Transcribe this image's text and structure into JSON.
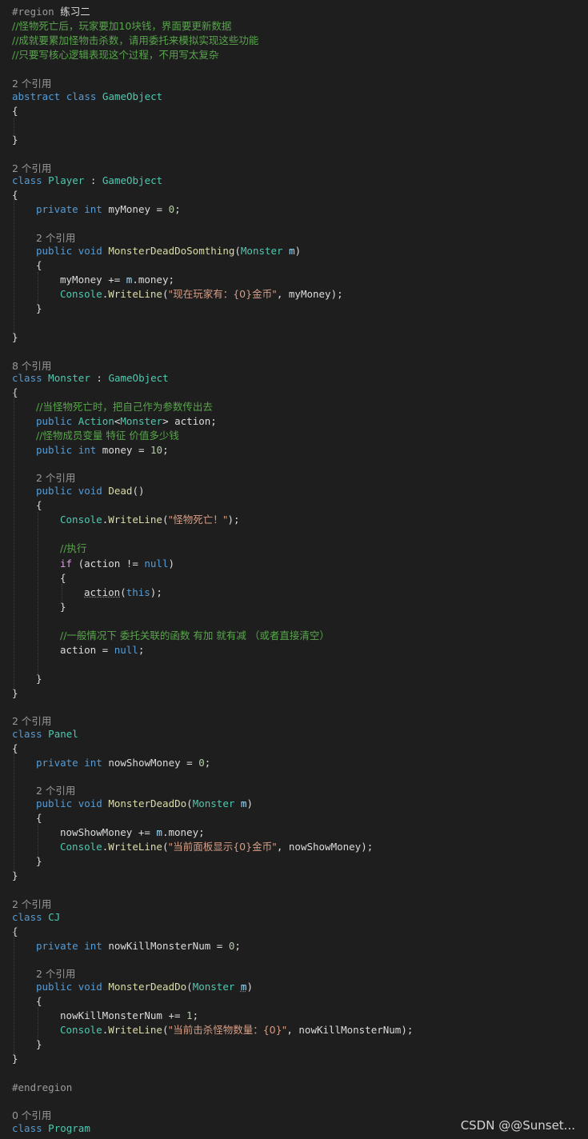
{
  "code": {
    "lines": [
      {
        "kind": "code",
        "spans": [
          {
            "t": "#region ",
            "c": "pre"
          },
          {
            "t": "练习二",
            "c": "plain"
          }
        ]
      },
      {
        "kind": "code",
        "spans": [
          {
            "t": "//怪物死亡后，玩家要加10块钱，界面要更新数据",
            "c": "cmt"
          }
        ]
      },
      {
        "kind": "code",
        "spans": [
          {
            "t": "//成就要累加怪物击杀数，请用委托来模拟实现这些功能",
            "c": "cmt"
          }
        ]
      },
      {
        "kind": "code",
        "spans": [
          {
            "t": "//只要写核心逻辑表现这个过程，不用写太复杂",
            "c": "cmt"
          }
        ]
      },
      {
        "kind": "lens",
        "spans": [
          {
            "t": "2 个引用",
            "c": "lens"
          }
        ]
      },
      {
        "kind": "code",
        "spans": [
          {
            "t": "abstract",
            "c": "kw"
          },
          {
            "t": " ",
            "c": "plain"
          },
          {
            "t": "class",
            "c": "kw"
          },
          {
            "t": " ",
            "c": "plain"
          },
          {
            "t": "GameObject",
            "c": "type"
          }
        ]
      },
      {
        "kind": "code",
        "spans": [
          {
            "t": "{",
            "c": "plain"
          }
        ]
      },
      {
        "kind": "code",
        "spans": [
          {
            "t": "}",
            "c": "plain"
          }
        ]
      },
      {
        "kind": "lens",
        "spans": [
          {
            "t": "2 个引用",
            "c": "lens"
          }
        ]
      },
      {
        "kind": "code",
        "spans": [
          {
            "t": "class",
            "c": "kw"
          },
          {
            "t": " ",
            "c": "plain"
          },
          {
            "t": "Player",
            "c": "type"
          },
          {
            "t": " : ",
            "c": "plain"
          },
          {
            "t": "GameObject",
            "c": "type"
          }
        ]
      },
      {
        "kind": "code",
        "spans": [
          {
            "t": "{",
            "c": "plain"
          }
        ]
      },
      {
        "kind": "code",
        "spans": [
          {
            "t": "private",
            "c": "kw"
          },
          {
            "t": " ",
            "c": "plain"
          },
          {
            "t": "int",
            "c": "kw"
          },
          {
            "t": " myMoney = ",
            "c": "plain"
          },
          {
            "t": "0",
            "c": "num"
          },
          {
            "t": ";",
            "c": "plain"
          }
        ]
      },
      {
        "kind": "lens",
        "spans": [
          {
            "t": "2 个引用",
            "c": "lens"
          }
        ]
      },
      {
        "kind": "code",
        "spans": [
          {
            "t": "public",
            "c": "kw"
          },
          {
            "t": " ",
            "c": "plain"
          },
          {
            "t": "void",
            "c": "kw"
          },
          {
            "t": " ",
            "c": "plain"
          },
          {
            "t": "MonsterDeadDoSomthing",
            "c": "fn"
          },
          {
            "t": "(",
            "c": "plain"
          },
          {
            "t": "Monster",
            "c": "type"
          },
          {
            "t": " ",
            "c": "plain"
          },
          {
            "t": "m",
            "c": "prm"
          },
          {
            "t": ")",
            "c": "plain"
          }
        ]
      },
      {
        "kind": "code",
        "spans": [
          {
            "t": "{",
            "c": "plain"
          }
        ]
      },
      {
        "kind": "code",
        "spans": [
          {
            "t": "myMoney += ",
            "c": "plain"
          },
          {
            "t": "m",
            "c": "prm"
          },
          {
            "t": ".money;",
            "c": "plain"
          }
        ]
      },
      {
        "kind": "code",
        "spans": [
          {
            "t": "Console",
            "c": "type"
          },
          {
            "t": ".",
            "c": "plain"
          },
          {
            "t": "WriteLine",
            "c": "fn"
          },
          {
            "t": "(",
            "c": "plain"
          },
          {
            "t": "\"现在玩家有：{0}金币\"",
            "c": "str"
          },
          {
            "t": ", myMoney);",
            "c": "plain"
          }
        ]
      },
      {
        "kind": "code",
        "spans": [
          {
            "t": "}",
            "c": "plain"
          }
        ]
      },
      {
        "kind": "code",
        "spans": [
          {
            "t": "}",
            "c": "plain"
          }
        ]
      },
      {
        "kind": "lens",
        "spans": [
          {
            "t": "8 个引用",
            "c": "lens"
          }
        ]
      },
      {
        "kind": "code",
        "spans": [
          {
            "t": "class",
            "c": "kw"
          },
          {
            "t": " ",
            "c": "plain"
          },
          {
            "t": "Monster",
            "c": "type"
          },
          {
            "t": " : ",
            "c": "plain"
          },
          {
            "t": "GameObject",
            "c": "type"
          }
        ]
      },
      {
        "kind": "code",
        "spans": [
          {
            "t": "{",
            "c": "plain"
          }
        ]
      },
      {
        "kind": "code",
        "spans": [
          {
            "t": "//当怪物死亡时，把自己作为参数传出去",
            "c": "cmt"
          }
        ]
      },
      {
        "kind": "code",
        "spans": [
          {
            "t": "public",
            "c": "kw"
          },
          {
            "t": " ",
            "c": "plain"
          },
          {
            "t": "Action",
            "c": "type"
          },
          {
            "t": "<",
            "c": "plain"
          },
          {
            "t": "Monster",
            "c": "type"
          },
          {
            "t": "> action;",
            "c": "plain"
          }
        ]
      },
      {
        "kind": "code",
        "spans": [
          {
            "t": "//怪物成员变量 特征 价值多少钱",
            "c": "cmt"
          }
        ]
      },
      {
        "kind": "code",
        "spans": [
          {
            "t": "public",
            "c": "kw"
          },
          {
            "t": " ",
            "c": "plain"
          },
          {
            "t": "int",
            "c": "kw"
          },
          {
            "t": " money = ",
            "c": "plain"
          },
          {
            "t": "10",
            "c": "num"
          },
          {
            "t": ";",
            "c": "plain"
          }
        ]
      },
      {
        "kind": "lens",
        "spans": [
          {
            "t": "2 个引用",
            "c": "lens"
          }
        ]
      },
      {
        "kind": "code",
        "spans": [
          {
            "t": "public",
            "c": "kw"
          },
          {
            "t": " ",
            "c": "plain"
          },
          {
            "t": "void",
            "c": "kw"
          },
          {
            "t": " ",
            "c": "plain"
          },
          {
            "t": "Dead",
            "c": "fn"
          },
          {
            "t": "()",
            "c": "plain"
          }
        ]
      },
      {
        "kind": "code",
        "spans": [
          {
            "t": "{",
            "c": "plain"
          }
        ]
      },
      {
        "kind": "code",
        "spans": [
          {
            "t": "Console",
            "c": "type"
          },
          {
            "t": ".",
            "c": "plain"
          },
          {
            "t": "WriteLine",
            "c": "fn"
          },
          {
            "t": "(",
            "c": "plain"
          },
          {
            "t": "\"怪物死亡！\"",
            "c": "str"
          },
          {
            "t": ");",
            "c": "plain"
          }
        ]
      },
      {
        "kind": "code",
        "spans": [
          {
            "t": "//执行",
            "c": "cmt"
          }
        ]
      },
      {
        "kind": "code",
        "spans": [
          {
            "t": "if",
            "c": "ctrl"
          },
          {
            "t": " (action != ",
            "c": "plain"
          },
          {
            "t": "null",
            "c": "kw"
          },
          {
            "t": ")",
            "c": "plain"
          }
        ]
      },
      {
        "kind": "code",
        "spans": [
          {
            "t": "{",
            "c": "plain"
          }
        ]
      },
      {
        "kind": "code",
        "spans": [
          {
            "t": "action",
            "c": "squig"
          },
          {
            "t": "(",
            "c": "plain"
          },
          {
            "t": "this",
            "c": "kw"
          },
          {
            "t": ");",
            "c": "plain"
          }
        ]
      },
      {
        "kind": "code",
        "spans": [
          {
            "t": "}",
            "c": "plain"
          }
        ]
      },
      {
        "kind": "code",
        "spans": [
          {
            "t": "//一般情况下 委托关联的函数 有加 就有减 （或者直接清空）",
            "c": "cmt"
          }
        ]
      },
      {
        "kind": "code",
        "spans": [
          {
            "t": "action = ",
            "c": "plain"
          },
          {
            "t": "null",
            "c": "kw"
          },
          {
            "t": ";",
            "c": "plain"
          }
        ]
      },
      {
        "kind": "code",
        "spans": [
          {
            "t": "}",
            "c": "plain"
          }
        ]
      },
      {
        "kind": "code",
        "spans": [
          {
            "t": "}",
            "c": "plain"
          }
        ]
      },
      {
        "kind": "lens",
        "spans": [
          {
            "t": "2 个引用",
            "c": "lens"
          }
        ]
      },
      {
        "kind": "code",
        "spans": [
          {
            "t": "class",
            "c": "kw"
          },
          {
            "t": " ",
            "c": "plain"
          },
          {
            "t": "Panel",
            "c": "type"
          }
        ]
      },
      {
        "kind": "code",
        "spans": [
          {
            "t": "{",
            "c": "plain"
          }
        ]
      },
      {
        "kind": "code",
        "spans": [
          {
            "t": "private",
            "c": "kw"
          },
          {
            "t": " ",
            "c": "plain"
          },
          {
            "t": "int",
            "c": "kw"
          },
          {
            "t": " nowShowMoney = ",
            "c": "plain"
          },
          {
            "t": "0",
            "c": "num"
          },
          {
            "t": ";",
            "c": "plain"
          }
        ]
      },
      {
        "kind": "lens",
        "spans": [
          {
            "t": "2 个引用",
            "c": "lens"
          }
        ]
      },
      {
        "kind": "code",
        "spans": [
          {
            "t": "public",
            "c": "kw"
          },
          {
            "t": " ",
            "c": "plain"
          },
          {
            "t": "void",
            "c": "kw"
          },
          {
            "t": " ",
            "c": "plain"
          },
          {
            "t": "MonsterDeadDo",
            "c": "fn"
          },
          {
            "t": "(",
            "c": "plain"
          },
          {
            "t": "Monster",
            "c": "type"
          },
          {
            "t": " ",
            "c": "plain"
          },
          {
            "t": "m",
            "c": "prm"
          },
          {
            "t": ")",
            "c": "plain"
          }
        ]
      },
      {
        "kind": "code",
        "spans": [
          {
            "t": "{",
            "c": "plain"
          }
        ]
      },
      {
        "kind": "code",
        "spans": [
          {
            "t": "nowShowMoney += ",
            "c": "plain"
          },
          {
            "t": "m",
            "c": "prm"
          },
          {
            "t": ".money;",
            "c": "plain"
          }
        ]
      },
      {
        "kind": "code",
        "spans": [
          {
            "t": "Console",
            "c": "type"
          },
          {
            "t": ".",
            "c": "plain"
          },
          {
            "t": "WriteLine",
            "c": "fn"
          },
          {
            "t": "(",
            "c": "plain"
          },
          {
            "t": "\"当前面板显示{0}金币\"",
            "c": "str"
          },
          {
            "t": ", nowShowMoney);",
            "c": "plain"
          }
        ]
      },
      {
        "kind": "code",
        "spans": [
          {
            "t": "}",
            "c": "plain"
          }
        ]
      },
      {
        "kind": "code",
        "spans": [
          {
            "t": "}",
            "c": "plain"
          }
        ]
      },
      {
        "kind": "lens",
        "spans": [
          {
            "t": "2 个引用",
            "c": "lens"
          }
        ]
      },
      {
        "kind": "code",
        "spans": [
          {
            "t": "class",
            "c": "kw"
          },
          {
            "t": " ",
            "c": "plain"
          },
          {
            "t": "CJ",
            "c": "type"
          }
        ]
      },
      {
        "kind": "code",
        "spans": [
          {
            "t": "{",
            "c": "plain"
          }
        ]
      },
      {
        "kind": "code",
        "spans": [
          {
            "t": "private",
            "c": "kw"
          },
          {
            "t": " ",
            "c": "plain"
          },
          {
            "t": "int",
            "c": "kw"
          },
          {
            "t": " nowKillMonsterNum = ",
            "c": "plain"
          },
          {
            "t": "0",
            "c": "num"
          },
          {
            "t": ";",
            "c": "plain"
          }
        ]
      },
      {
        "kind": "lens",
        "spans": [
          {
            "t": "2 个引用",
            "c": "lens"
          }
        ]
      },
      {
        "kind": "code",
        "spans": [
          {
            "t": "public",
            "c": "kw"
          },
          {
            "t": " ",
            "c": "plain"
          },
          {
            "t": "void",
            "c": "kw"
          },
          {
            "t": " ",
            "c": "plain"
          },
          {
            "t": "MonsterDeadDo",
            "c": "fn"
          },
          {
            "t": "(",
            "c": "plain"
          },
          {
            "t": "Monster",
            "c": "type"
          },
          {
            "t": " ",
            "c": "plain"
          },
          {
            "t": "m",
            "c": "prm squig"
          },
          {
            "t": ")",
            "c": "plain"
          }
        ]
      },
      {
        "kind": "code",
        "spans": [
          {
            "t": "{",
            "c": "plain"
          }
        ]
      },
      {
        "kind": "code",
        "spans": [
          {
            "t": "nowKillMonsterNum += ",
            "c": "plain"
          },
          {
            "t": "1",
            "c": "num"
          },
          {
            "t": ";",
            "c": "plain"
          }
        ]
      },
      {
        "kind": "code",
        "spans": [
          {
            "t": "Console",
            "c": "type"
          },
          {
            "t": ".",
            "c": "plain"
          },
          {
            "t": "WriteLine",
            "c": "fn"
          },
          {
            "t": "(",
            "c": "plain"
          },
          {
            "t": "\"当前击杀怪物数量：{0}\"",
            "c": "str"
          },
          {
            "t": ", nowKillMonsterNum);",
            "c": "plain"
          }
        ]
      },
      {
        "kind": "code",
        "spans": [
          {
            "t": "}",
            "c": "plain"
          }
        ]
      },
      {
        "kind": "code",
        "spans": [
          {
            "t": "}",
            "c": "plain"
          }
        ]
      },
      {
        "kind": "code",
        "spans": [
          {
            "t": "#endregion",
            "c": "pre"
          }
        ]
      },
      {
        "kind": "lens",
        "spans": [
          {
            "t": "0 个引用",
            "c": "lens"
          }
        ]
      },
      {
        "kind": "code",
        "spans": [
          {
            "t": "class",
            "c": "kw"
          },
          {
            "t": " ",
            "c": "plain"
          },
          {
            "t": "Program",
            "c": "type"
          }
        ]
      }
    ]
  },
  "watermark": "CSDN @@Sunset...",
  "colors": {
    "background": "#1e1e1e",
    "keyword": "#569cd6",
    "type": "#4ec9b0",
    "method": "#dcdcaa",
    "string": "#d69d85",
    "comment": "#57a64a",
    "number": "#b5cea8",
    "parameter": "#9cdcfe"
  }
}
